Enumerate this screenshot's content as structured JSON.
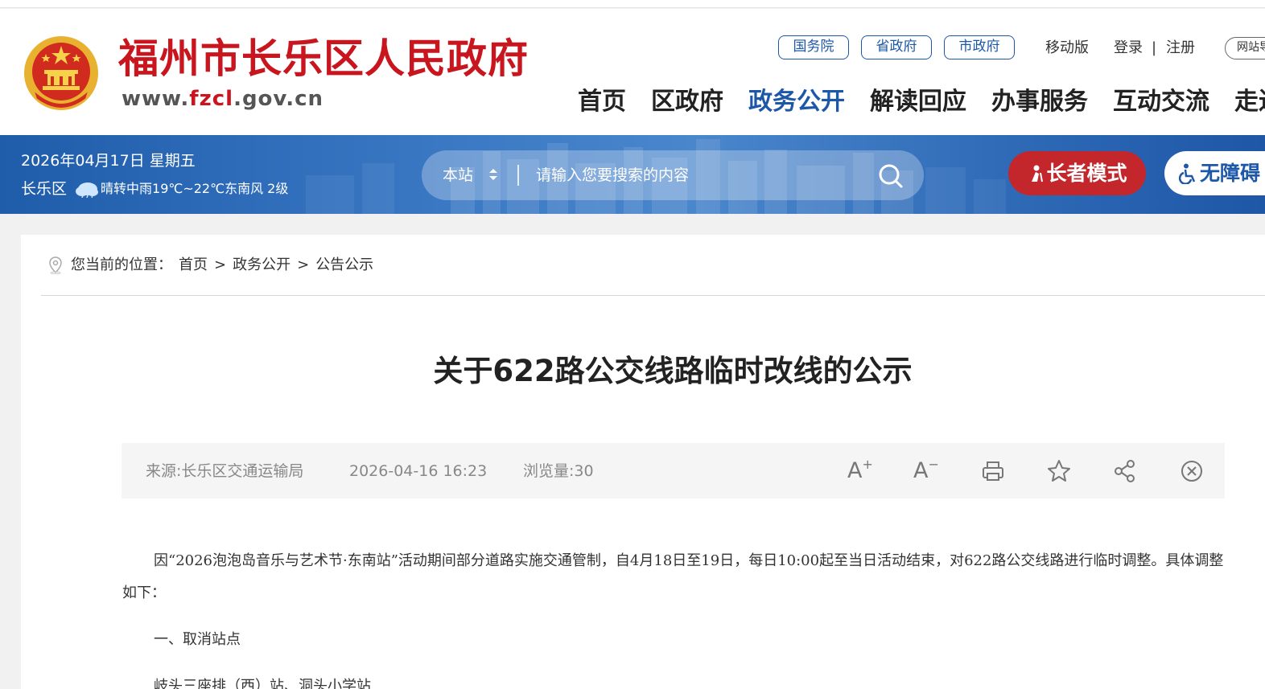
{
  "header": {
    "site_title": "福州市长乐区人民政府",
    "url_prefix": "www.",
    "url_highlight": "fzcl",
    "url_suffix": ".gov.cn",
    "gov_links": [
      "国务院",
      "省政府",
      "市政府"
    ],
    "mobile": "移动版",
    "login": "登录",
    "separator": "|",
    "register": "注册",
    "site_nav": "网站导航",
    "nav": [
      "首页",
      "区政府",
      "政务公开",
      "解读回应",
      "办事服务",
      "互动交流",
      "走进长乐"
    ],
    "active_nav": "政务公开"
  },
  "banner": {
    "date": "2026年04月17日 星期五",
    "district": "长乐区",
    "weather": "晴转中雨19℃~22℃东南风 2级",
    "search_scope": "本站",
    "search_placeholder": "请输入您要搜索的内容",
    "elder_mode": "长者模式",
    "accessible": "无障碍"
  },
  "breadcrumb": {
    "prefix": "您当前的位置：",
    "items": [
      "首页",
      "政务公开",
      "公告公示"
    ],
    "sep": ">"
  },
  "article": {
    "title": "关于622路公交线路临时改线的公示",
    "source": "来源:长乐区交通运输局",
    "datetime": "2026-04-16 16:23",
    "views": "浏览量:30",
    "paragraphs": [
      "因“2026泡泡岛音乐与艺术节·东南站”活动期间部分道路实施交通管制，自4月18日至19日，每日10:00起至当日活动结束，对622路公交线路进行临时调整。具体调整如下：",
      "一、取消站点",
      "岐头三座排（西）站、洞头小学站"
    ]
  },
  "tools": [
    "font-increase-icon",
    "font-decrease-icon",
    "print-icon",
    "favorite-icon",
    "share-icon",
    "close-icon"
  ],
  "colors": {
    "brand_red": "#c9151e",
    "nav_blue": "#1d58a8",
    "elder_red": "#c4272b"
  }
}
